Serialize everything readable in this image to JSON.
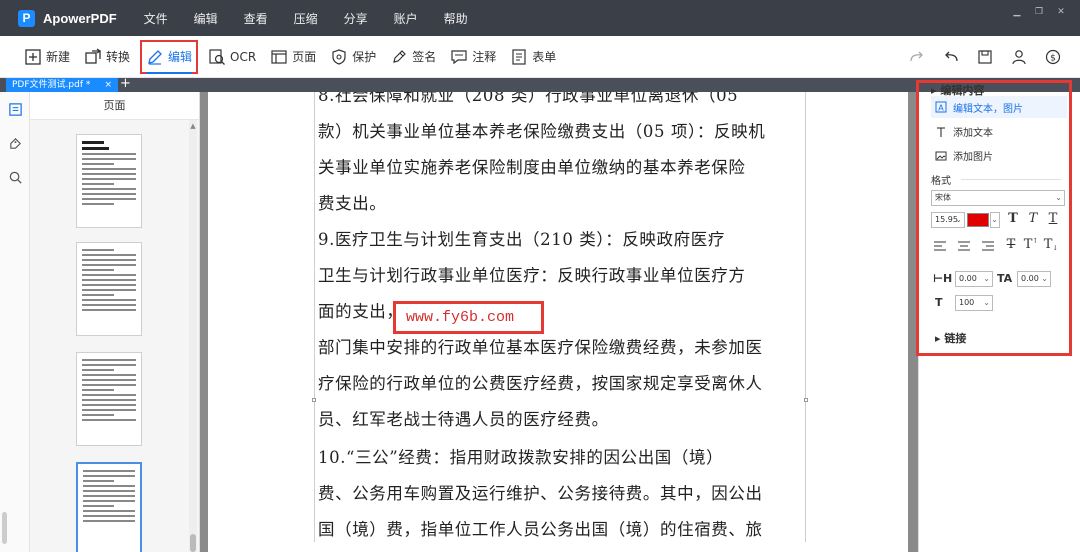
{
  "app": {
    "title": "ApowerPDF",
    "logo_letter": "P",
    "menu": [
      "文件",
      "编辑",
      "查看",
      "压缩",
      "分享",
      "账户",
      "帮助"
    ]
  },
  "toolbar": {
    "new": "新建",
    "convert": "转换",
    "edit": "编辑",
    "ocr": "OCR",
    "page": "页面",
    "protect": "保护",
    "sign": "签名",
    "comment": "注释",
    "form": "表单"
  },
  "tab": {
    "label": "PDF文件测试.pdf *",
    "close": "×",
    "add": "+"
  },
  "thumbnails": {
    "title": "页面"
  },
  "document": {
    "paragraphs": [
      "8.社会保障和就业（208 类）行政事业单位离退休（05",
      "款）机关事业单位基本养老保险缴费支出（05 项）：反映机",
      "关事业单位实施养老保险制度由单位缴纳的基本养老保险",
      "费支出。",
      "9.医疗卫生与计划生育支出（210 类）：反映政府医疗",
      "卫生与计划行政事业单位医疗：反映行政事业单位医疗方",
      "面的支出",
      "部门集中安排的行政单位基本医疗保险缴费经费，未参加医",
      "疗保险的行政单位的公费医疗经费，按国家规定享受离休人",
      "员、红军老战士待遇人员的医疗经费。",
      "10.“三公”经费：指用财政拨款安排的因公出国（境）",
      "费、公务用车购置及运行维护、公务接待费。其中，因公出",
      "国（境）费，指单位工作人员公务出国（境）的住宿费、旅"
    ],
    "url": "www.fy6b.com",
    "url_prefix": "，"
  },
  "properties": {
    "section_edit": "编辑内容",
    "edit_text_image": "编辑文本，图片",
    "add_text": "添加文本",
    "add_image": "添加图片",
    "format_label": "格式",
    "font": "宋体",
    "font_size": "15.95",
    "color": "#e00000",
    "char_spacing": "0.00",
    "word_spacing": "0.00",
    "scale": "100",
    "link_label": "链接"
  }
}
